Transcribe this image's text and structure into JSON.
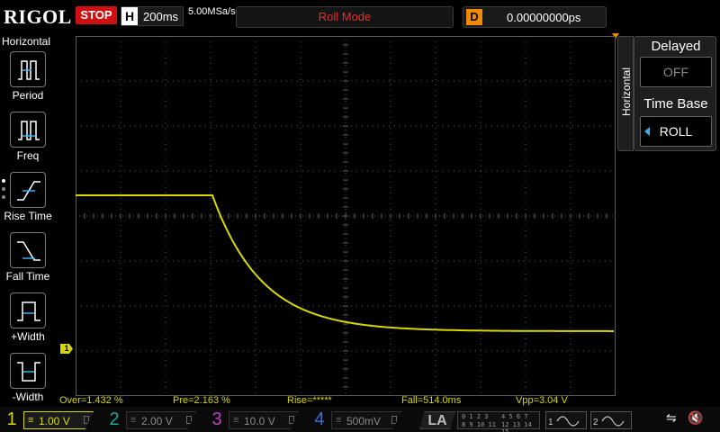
{
  "header": {
    "logo": "RIGOL",
    "run_state": "STOP",
    "timebase_letter": "H",
    "timebase_value": "200ms",
    "sample_rate": "5.00MSa/s",
    "mode": "Roll Mode",
    "delay_letter": "D",
    "delay_value": "0.00000000ps"
  },
  "left_menu": {
    "title": "Horizontal",
    "items": [
      {
        "label": "Period",
        "icon": "period-icon"
      },
      {
        "label": "Freq",
        "icon": "freq-icon"
      },
      {
        "label": "Rise Time",
        "icon": "rise-time-icon"
      },
      {
        "label": "Fall Time",
        "icon": "fall-time-icon"
      },
      {
        "label": "+Width",
        "icon": "pos-width-icon"
      },
      {
        "label": "-Width",
        "icon": "neg-width-icon"
      }
    ]
  },
  "right_menu": {
    "tab_label": "Horizontal",
    "delayed_title": "Delayed",
    "delayed_value": "OFF",
    "timebase_title": "Time Base",
    "timebase_value": "ROLL"
  },
  "markers": {
    "ch1": "1"
  },
  "measurements": {
    "over": "Over=1.432 %",
    "pre": "Pre=2.163 %",
    "rise": "Rise=*****",
    "fall": "Fall=514.0ms",
    "vpp": "Vpp=3.04 V"
  },
  "channels": [
    {
      "num": "1",
      "value": "1.00 V",
      "color": "#d8d800"
    },
    {
      "num": "2",
      "value": "2.00 V",
      "color": "#1aa89a"
    },
    {
      "num": "3",
      "value": "10.0 V",
      "color": "#c040c0"
    },
    {
      "num": "4",
      "value": "500mV",
      "color": "#3a70e0"
    }
  ],
  "la_label": "LA",
  "la_digits": [
    "0 1 2 3",
    "4 5 6 7",
    "8 9 10 11",
    "12 13 14 15"
  ],
  "generators": [
    "1",
    "2"
  ],
  "colors": {
    "ch1_trace": "#d8d800",
    "grid": "#5a5a5a",
    "stop": "#d01010",
    "mode_text": "#e03030",
    "delay_badge": "#f08a00"
  }
}
